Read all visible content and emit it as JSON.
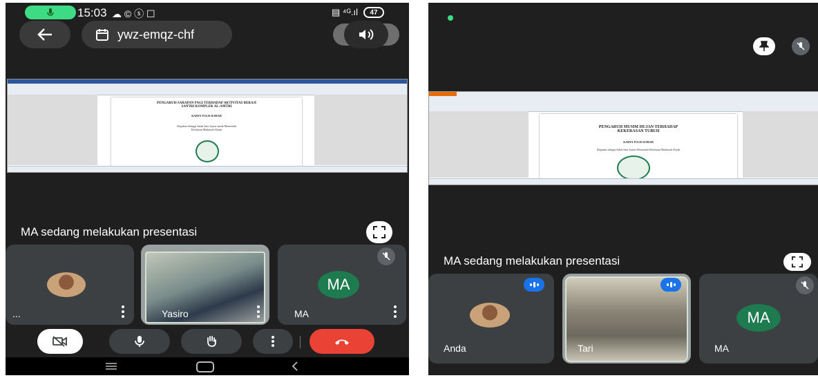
{
  "left": {
    "status_bar": {
      "time": "15:03",
      "status_icons": "☁ © ⓢ ☐",
      "right_icons": "▤ ⁴ᴳ.ıl",
      "battery": "47"
    },
    "header": {
      "meeting_code": "ywz-emqz-chf"
    },
    "document": {
      "title_line1": "PENGARUH SARAPAN PAGI TERHADAP AKTIVITAS BERAJI",
      "title_line2": "SANTRI KOMPLEK AL-AMTRI",
      "author": "KARYA TULIS ILMIAH",
      "subtitle_line1": "Diajukan Sebagai Salah Satu Syarat untuk Memenuhi",
      "subtitle_line2": "Kelulusan Madrasah Aliyah"
    },
    "presenting_text": "MA sedang melakukan presentasi",
    "tiles": [
      {
        "name": "..."
      },
      {
        "name": "Yasiro"
      },
      {
        "name": "MA",
        "initials": "MA"
      }
    ],
    "controls": [
      "camera-off",
      "mic",
      "raise-hand",
      "more",
      "end-call"
    ]
  },
  "right": {
    "document": {
      "title_line1": "PENGARUH MUSIM HUJAN TERHADAP",
      "title_line2": "KEKERASAN TUBUH",
      "author": "KARYA TULIS ILMIAH",
      "subtitle_line1": "Diajukan sebagai Salah Satu Syarat Memenuhi Kelulusan Madrasah Aliyah"
    },
    "presenting_text": "MA sedang melakukan presentasi",
    "tiles": [
      {
        "name": "Anda"
      },
      {
        "name": "Tari"
      },
      {
        "name": "MA",
        "initials": "MA"
      }
    ]
  },
  "colors": {
    "background": "#1f1f1f",
    "tile": "#3c4043",
    "accent_green": "#3ddc84",
    "end_call": "#ea4335",
    "ma_avatar": "#1e7a4f",
    "speaking": "#1a73e8"
  }
}
